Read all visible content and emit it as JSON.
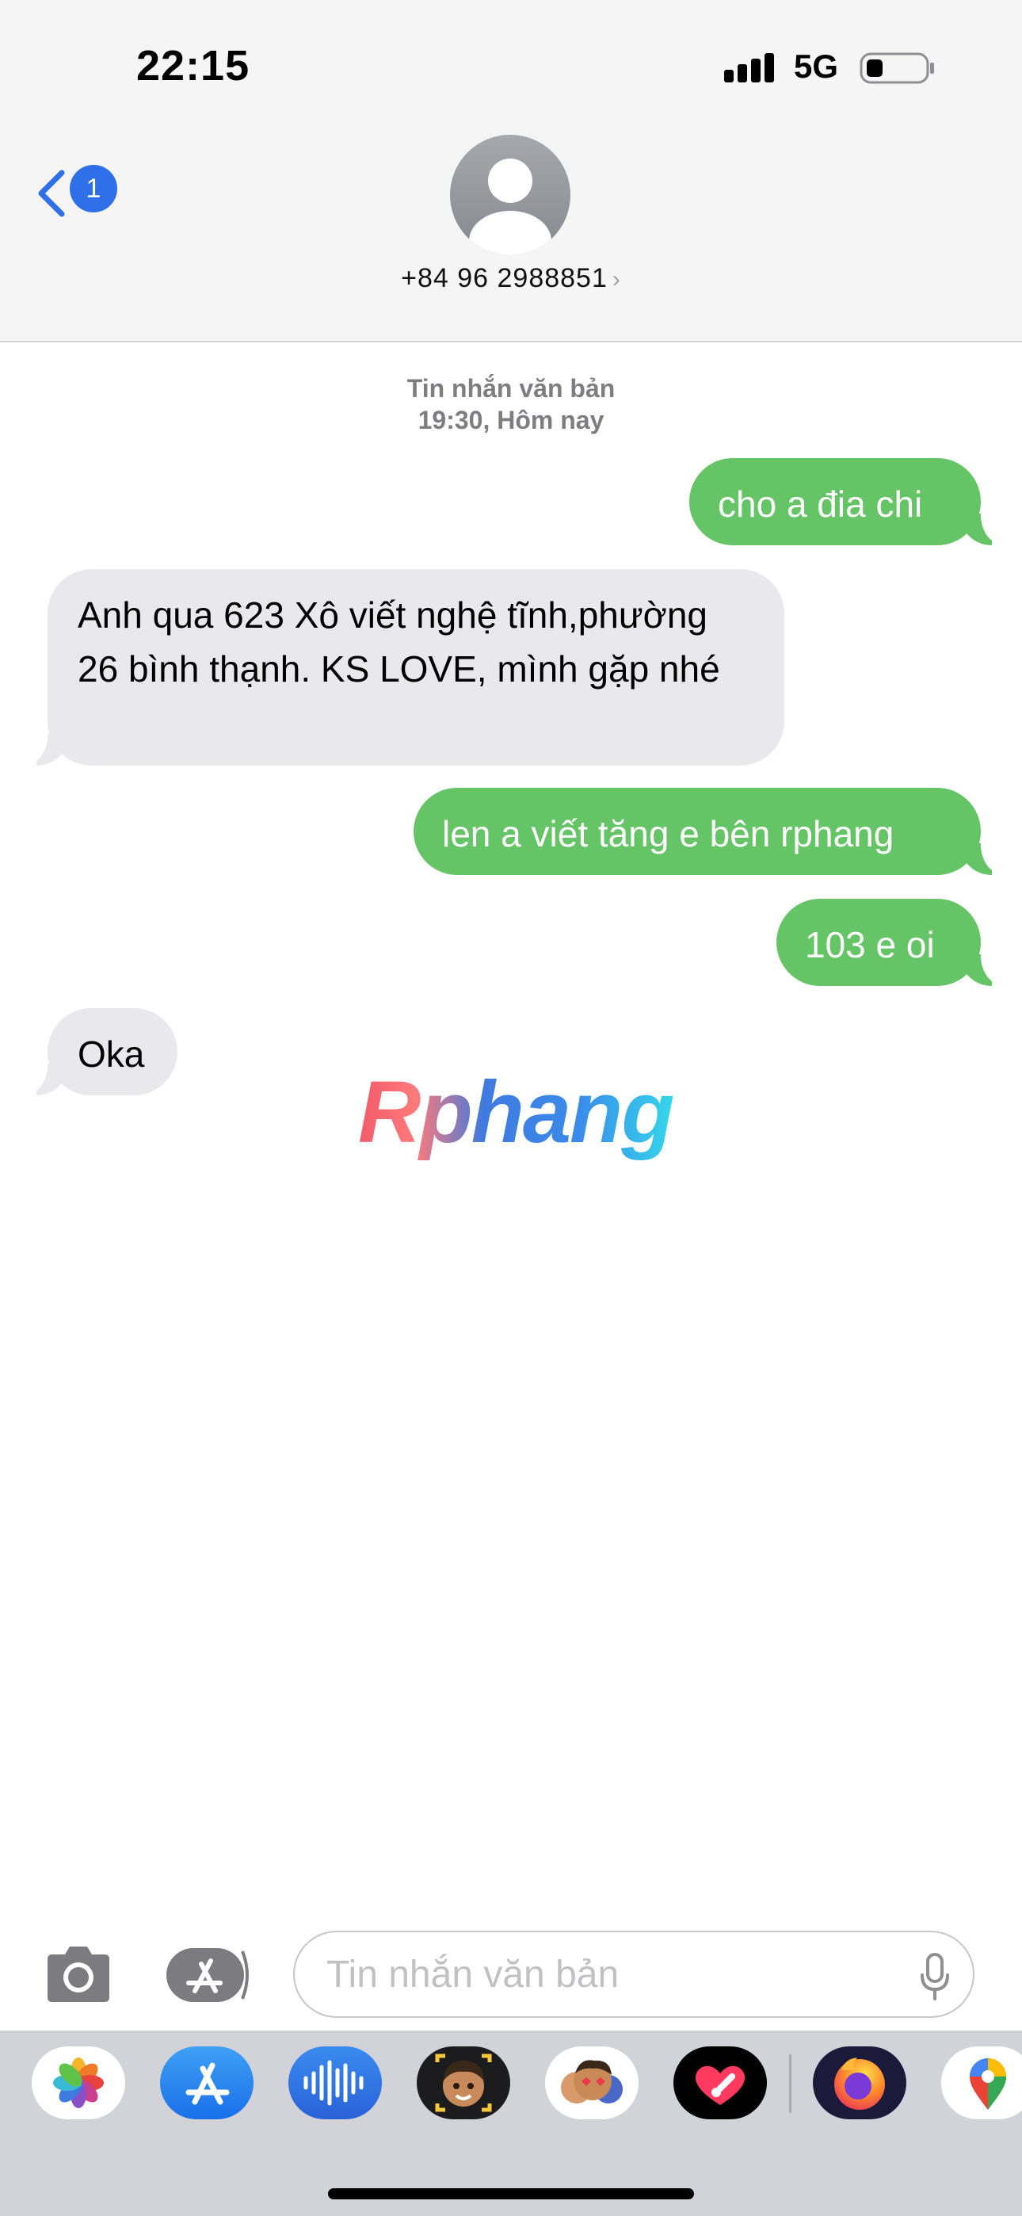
{
  "status_bar": {
    "time": "22:15",
    "network": "5G"
  },
  "header": {
    "back_badge": "1",
    "contact": "+84 96 2988851",
    "contact_chevron": "›"
  },
  "thread": {
    "meta_line1": "Tin nhắn văn bản",
    "meta_line2": "19:30, Hôm nay",
    "messages": [
      {
        "direction": "sent",
        "text": "cho a đia chi"
      },
      {
        "direction": "received",
        "text": "Anh qua 623 Xô viết nghệ tĩnh,phường 26 bình thạnh. KS LOVE, mình gặp nhé"
      },
      {
        "direction": "sent",
        "text": "len a viết tăng e bên rphang"
      },
      {
        "direction": "sent",
        "text": "103 e oi"
      },
      {
        "direction": "received",
        "text": "Oka"
      }
    ]
  },
  "watermark": "Rphang",
  "input": {
    "placeholder": "Tin nhắn văn bản",
    "value": ""
  },
  "app_drawer": {
    "apps": [
      "photos-app",
      "app-store-app",
      "audio-message-app",
      "memoji-app",
      "animoji-stickers-app",
      "digital-touch-app",
      "firefox-app",
      "google-maps-app"
    ]
  },
  "colors": {
    "sent_bubble": "#65c466",
    "received_bubble": "#e9e9eb",
    "accent": "#2f6fe7"
  }
}
